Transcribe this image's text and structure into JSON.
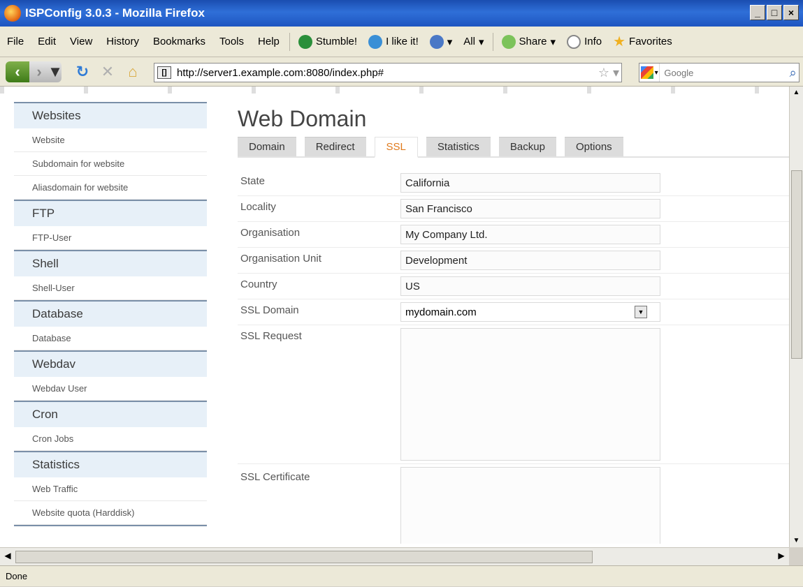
{
  "window": {
    "title": "ISPConfig 3.0.3 - Mozilla Firefox"
  },
  "menu": {
    "items": [
      "File",
      "Edit",
      "View",
      "History",
      "Bookmarks",
      "Tools",
      "Help"
    ],
    "toolbar": [
      "Stumble!",
      "I like it!",
      "All",
      "Share",
      "Info",
      "Favorites"
    ]
  },
  "nav": {
    "url": "http://server1.example.com:8080/index.php#",
    "search_placeholder": "Google"
  },
  "sidebar": {
    "groups": [
      {
        "title": "Websites",
        "items": [
          "Website",
          "Subdomain for website",
          "Aliasdomain for website"
        ]
      },
      {
        "title": "FTP",
        "items": [
          "FTP-User"
        ]
      },
      {
        "title": "Shell",
        "items": [
          "Shell-User"
        ]
      },
      {
        "title": "Database",
        "items": [
          "Database"
        ]
      },
      {
        "title": "Webdav",
        "items": [
          "Webdav User"
        ]
      },
      {
        "title": "Cron",
        "items": [
          "Cron Jobs"
        ]
      },
      {
        "title": "Statistics",
        "items": [
          "Web Traffic",
          "Website quota (Harddisk)"
        ]
      }
    ]
  },
  "main": {
    "title": "Web Domain",
    "tabs": [
      "Domain",
      "Redirect",
      "SSL",
      "Statistics",
      "Backup",
      "Options"
    ],
    "active_tab": "SSL",
    "form": {
      "state": {
        "label": "State",
        "value": "California"
      },
      "locality": {
        "label": "Locality",
        "value": "San Francisco"
      },
      "organisation": {
        "label": "Organisation",
        "value": "My Company Ltd."
      },
      "organisation_unit": {
        "label": "Organisation Unit",
        "value": "Development"
      },
      "country": {
        "label": "Country",
        "value": "US"
      },
      "ssl_domain": {
        "label": "SSL Domain",
        "value": "mydomain.com"
      },
      "ssl_request": {
        "label": "SSL Request",
        "value": ""
      },
      "ssl_certificate": {
        "label": "SSL Certificate",
        "value": ""
      }
    }
  },
  "status": {
    "text": "Done"
  },
  "colors": {
    "active_tab": "#e07a1c",
    "sidebar_header_bg": "#e7f0f8",
    "titlebar": "#2f6fd8"
  }
}
